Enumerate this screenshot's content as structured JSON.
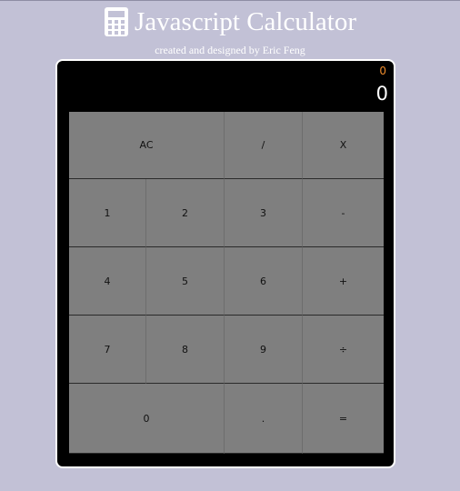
{
  "header": {
    "title": "Javascript Calculator",
    "subtitle": "created and designed by Eric Feng",
    "icon": "calculator-icon"
  },
  "display": {
    "formula": "0",
    "output": "0",
    "formula_color": "#f08c2c",
    "output_color": "#ffffff"
  },
  "keys": {
    "clear": "AC",
    "divide": "/",
    "multiply": "X",
    "one": "1",
    "two": "2",
    "three": "3",
    "subtract": "-",
    "four": "4",
    "five": "5",
    "six": "6",
    "add": "+",
    "seven": "7",
    "eight": "8",
    "nine": "9",
    "divide_alt": "÷",
    "zero": "0",
    "decimal": ".",
    "equals": "="
  },
  "colors": {
    "page_background": "#c2c1d6",
    "key_background": "#7f7f7f",
    "calculator_background": "#000000"
  }
}
